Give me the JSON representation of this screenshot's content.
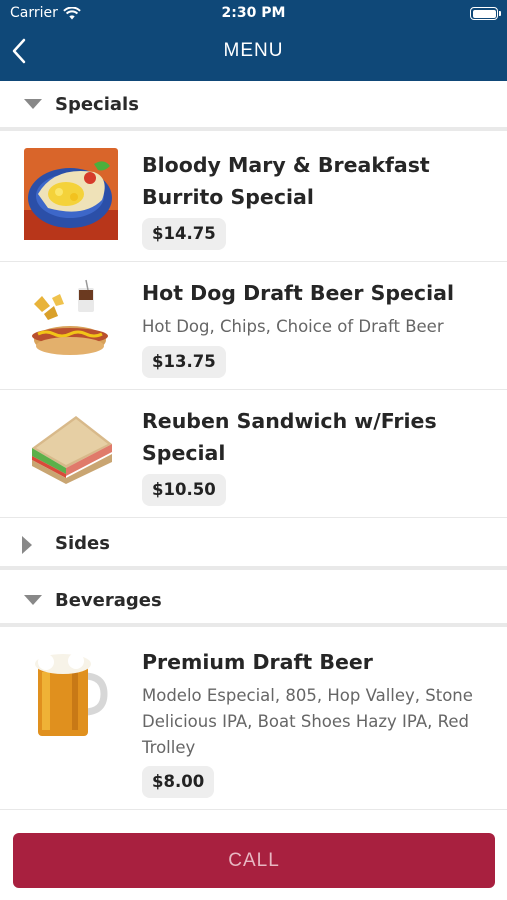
{
  "status_bar": {
    "carrier": "Carrier",
    "time": "2:30 PM"
  },
  "nav": {
    "title": "MENU"
  },
  "sections": {
    "specials": "Specials",
    "sides": "Sides",
    "beverages": "Beverages"
  },
  "items": {
    "burrito": {
      "name_line1": "Bloody Mary & Breakfast",
      "name_line2": "Burrito Special",
      "price": "$14.75"
    },
    "hotdog": {
      "name": "Hot Dog Draft Beer Special",
      "desc": "Hot Dog, Chips, Choice of Draft Beer",
      "price": "$13.75"
    },
    "reuben": {
      "name_line1": "Reuben Sandwich w/Fries",
      "name_line2": "Special",
      "price": "$10.50"
    },
    "beer": {
      "name": "Premium Draft Beer",
      "desc_line1": "Modelo Especial, 805, Hop Valley, Stone",
      "desc_line2": "Delicious IPA, Boat Shoes Hazy IPA, Red",
      "desc_line3": "Trolley",
      "price": "$8.00"
    }
  },
  "call_button": {
    "label": "CALL"
  },
  "colors": {
    "header": "#0f4878",
    "call_button": "#a8203f"
  }
}
